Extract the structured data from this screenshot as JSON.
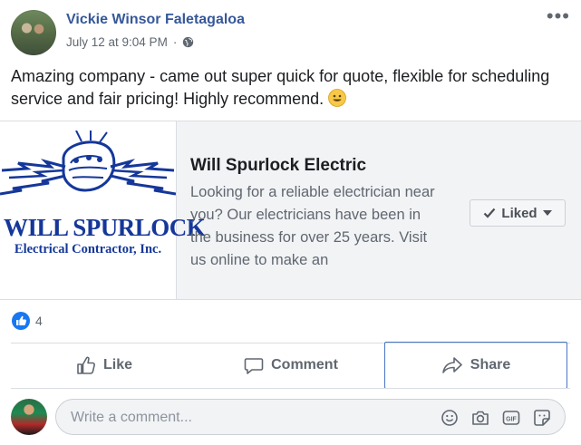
{
  "post": {
    "author": "Vickie Winsor Faletagaloa",
    "timestamp": "July 12 at 9:04 PM",
    "separator": "·",
    "privacy_icon": "globe-icon",
    "more_label": "•••",
    "text": "Amazing company - came out super quick for quote, flexible for scheduling service and fair pricing! Highly recommend.",
    "emoji": "smiling-face-icon"
  },
  "preview": {
    "logo_title": "WILL SPURLOCK",
    "logo_subtitle": "Electrical Contractor, Inc.",
    "title": "Will Spurlock Electric",
    "description": "Looking for a reliable electrician near you? Our electricians have been in the business for over 25 years. Visit us online to make an",
    "liked_label": "Liked"
  },
  "reactions": {
    "count": "4",
    "icon": "like-reaction-icon"
  },
  "actions": {
    "like": "Like",
    "comment": "Comment",
    "share": "Share"
  },
  "comment_box": {
    "placeholder": "Write a comment...",
    "icons": [
      "emoji-icon",
      "camera-icon",
      "gif-icon",
      "sticker-icon"
    ]
  },
  "colors": {
    "author_link": "#365899",
    "secondary_text": "#606770",
    "logo_blue": "#15379a",
    "like_blue": "#1877f2",
    "share_focus": "#4a76c5"
  }
}
